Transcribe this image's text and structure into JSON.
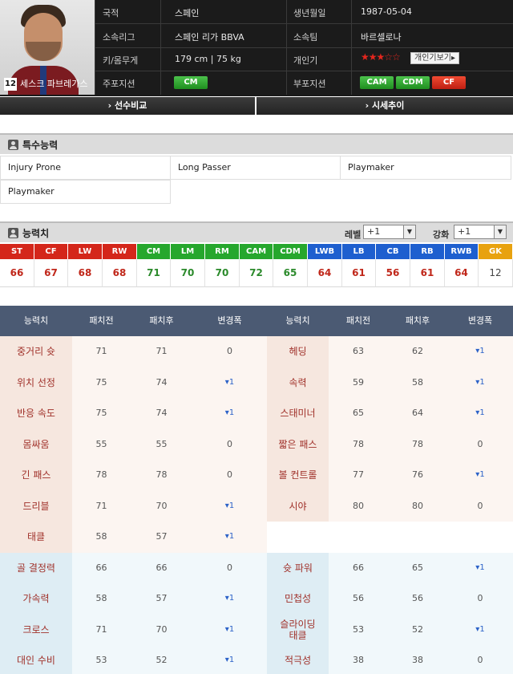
{
  "colors": {
    "attacker": "#d4261a",
    "midfielder": "#26a72d",
    "defender": "#1e5fcf",
    "goalkeeper": "#e8a20f",
    "header_bg": "#4b5a73",
    "stat_name": "#a0312a",
    "delta_up": "#2c62c8"
  },
  "player": {
    "number": "12",
    "name": "세스크 파브레가스",
    "nationality_label": "국적",
    "nationality": "스페인",
    "birth_label": "생년월일",
    "birth": "1987-05-04",
    "league_label": "소속리그",
    "league": "스페인 리가 BBVA",
    "team_label": "소속팀",
    "team": "바르셀로나",
    "body_label": "키/몸무게",
    "body": "179 cm  |  75 kg",
    "popularity_label": "개인기",
    "popularity_stars": "★★★☆☆",
    "personal_button": "개인기보기▸",
    "main_pos_label": "주포지션",
    "main_positions": [
      "CM"
    ],
    "sub_pos_label": "부포지션",
    "sub_positions": [
      "CAM",
      "CDM",
      "CF"
    ]
  },
  "nav": {
    "compare": "› 선수비교",
    "price": "› 시세추이"
  },
  "traits_section": {
    "title": "특수능력",
    "items": [
      "Injury Prone",
      "Long Passer",
      "Playmaker",
      "Playmaker"
    ]
  },
  "ratings_section": {
    "title": "능력치",
    "level_label": "레벨",
    "level_value": "+1",
    "enhance_label": "강화",
    "enhance_value": "+1",
    "arrow_icon": "chevron-down-icon",
    "positions": [
      {
        "pos": "ST",
        "val": "66",
        "group": "att"
      },
      {
        "pos": "CF",
        "val": "67",
        "group": "att"
      },
      {
        "pos": "LW",
        "val": "68",
        "group": "att"
      },
      {
        "pos": "RW",
        "val": "68",
        "group": "att"
      },
      {
        "pos": "CM",
        "val": "71",
        "group": "mid"
      },
      {
        "pos": "LM",
        "val": "70",
        "group": "mid"
      },
      {
        "pos": "RM",
        "val": "70",
        "group": "mid"
      },
      {
        "pos": "CAM",
        "val": "72",
        "group": "mid"
      },
      {
        "pos": "CDM",
        "val": "65",
        "group": "mid"
      },
      {
        "pos": "LWB",
        "val": "64",
        "group": "def"
      },
      {
        "pos": "LB",
        "val": "61",
        "group": "def"
      },
      {
        "pos": "CB",
        "val": "56",
        "group": "def"
      },
      {
        "pos": "RB",
        "val": "61",
        "group": "def"
      },
      {
        "pos": "RWB",
        "val": "64",
        "group": "def"
      },
      {
        "pos": "GK",
        "val": "12",
        "group": "gk"
      }
    ]
  },
  "stats_table": {
    "headers": [
      "능력치",
      "패치전",
      "패치후",
      "변경폭",
      "능력치",
      "패치전",
      "패치후",
      "변경폭"
    ],
    "rows": [
      {
        "l": [
          "중거리 슛",
          "71",
          "71",
          "0"
        ],
        "r": [
          "헤딩",
          "63",
          "62",
          "▾1"
        ]
      },
      {
        "l": [
          "위치 선정",
          "75",
          "74",
          "▾1"
        ],
        "r": [
          "속력",
          "59",
          "58",
          "▾1"
        ]
      },
      {
        "l": [
          "반응 속도",
          "75",
          "74",
          "▾1"
        ],
        "r": [
          "스태미너",
          "65",
          "64",
          "▾1"
        ]
      },
      {
        "l": [
          "몸싸움",
          "55",
          "55",
          "0"
        ],
        "r": [
          "짧은 패스",
          "78",
          "78",
          "0"
        ]
      },
      {
        "l": [
          "긴 패스",
          "78",
          "78",
          "0"
        ],
        "r": [
          "볼 컨트롤",
          "77",
          "76",
          "▾1"
        ]
      },
      {
        "l": [
          "드리블",
          "71",
          "70",
          "▾1"
        ],
        "r": [
          "시야",
          "80",
          "80",
          "0"
        ]
      },
      {
        "l": [
          "태클",
          "58",
          "57",
          "▾1"
        ],
        "r": null
      },
      {
        "l": [
          "골 결정력",
          "66",
          "66",
          "0"
        ],
        "r": [
          "슛 파워",
          "66",
          "65",
          "▾1"
        ]
      },
      {
        "l": [
          "가속력",
          "58",
          "57",
          "▾1"
        ],
        "r": [
          "민첩성",
          "56",
          "56",
          "0"
        ]
      },
      {
        "l": [
          "크로스",
          "71",
          "70",
          "▾1"
        ],
        "r": [
          "슬라이딩\n태클",
          "53",
          "52",
          "▾1"
        ]
      },
      {
        "l": [
          "대인 수비",
          "53",
          "52",
          "▾1"
        ],
        "r": [
          "적극성",
          "38",
          "38",
          "0"
        ]
      }
    ]
  }
}
